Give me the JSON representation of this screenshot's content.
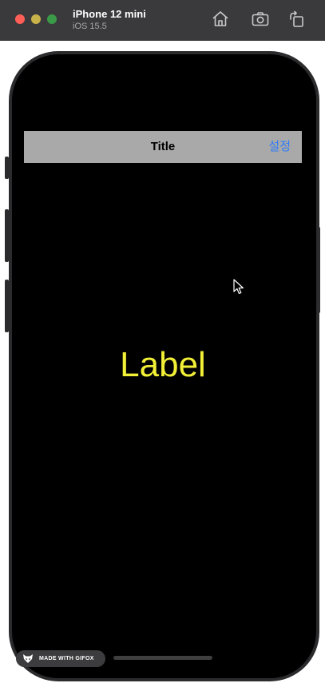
{
  "simulator": {
    "device_name": "iPhone 12 mini",
    "os_version": "iOS 15.5",
    "toolbar_icons": [
      "home-icon",
      "screenshot-icon",
      "rotate-icon"
    ]
  },
  "app": {
    "nav_title": "Title",
    "settings_button": "설정",
    "main_label": "Label",
    "colors": {
      "navbar_bg": "#a9a9a9",
      "settings_tint": "#2f7cf6",
      "label_color": "#f2f036",
      "background": "#000000"
    }
  },
  "watermark": {
    "text": "MADE WITH GIFOX"
  }
}
